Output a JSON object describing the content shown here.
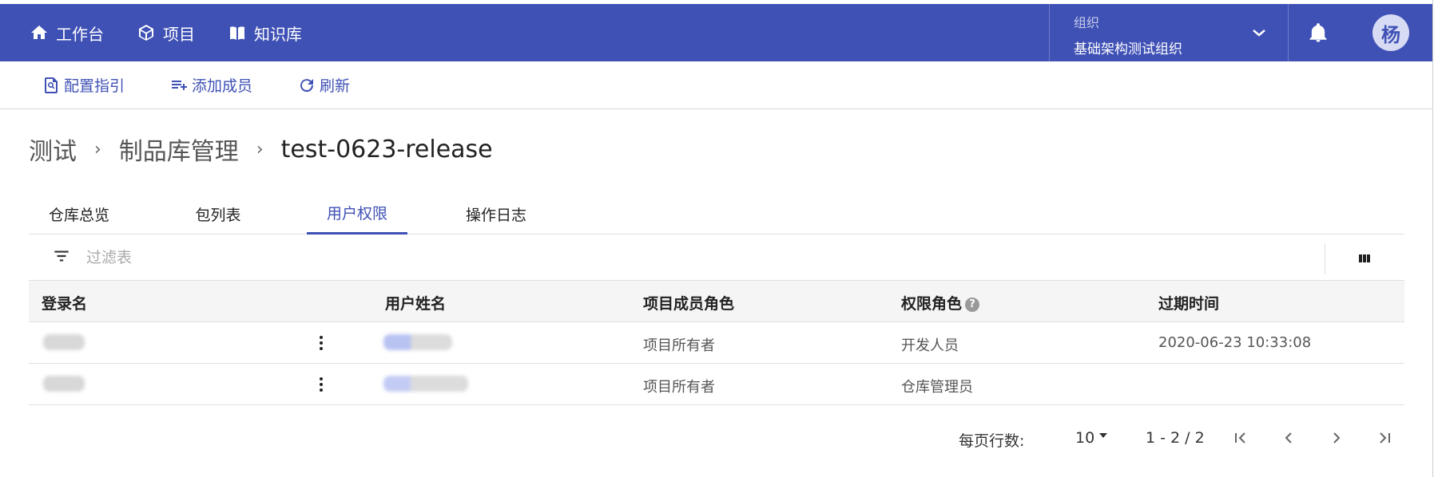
{
  "topnav": {
    "items": [
      {
        "label": "工作台",
        "icon": "home-icon"
      },
      {
        "label": "项目",
        "icon": "cube-icon"
      },
      {
        "label": "知识库",
        "icon": "book-icon"
      }
    ],
    "org_label": "组织",
    "org_name": "基础架构测试组织",
    "avatar_text": "杨"
  },
  "toolbar": {
    "config_guide": "配置指引",
    "add_member": "添加成员",
    "refresh": "刷新"
  },
  "breadcrumb": {
    "items": [
      "测试",
      "制品库管理",
      "test-0623-release"
    ]
  },
  "tabs": [
    "仓库总览",
    "包列表",
    "用户权限",
    "操作日志"
  ],
  "active_tab": "用户权限",
  "filter": {
    "placeholder": "过滤表"
  },
  "table": {
    "headers": [
      "登录名",
      "用户姓名",
      "项目成员角色",
      "权限角色",
      "过期时间"
    ],
    "rows": [
      {
        "login": "",
        "name": "",
        "member_role": "项目所有者",
        "permission_role": "开发人员",
        "expires": "2020-06-23 10:33:08"
      },
      {
        "login": "",
        "name": "",
        "member_role": "项目所有者",
        "permission_role": "仓库管理员",
        "expires": ""
      }
    ]
  },
  "pagination": {
    "rows_per_page_label": "每页行数:",
    "rows_per_page": "10",
    "range": "1 - 2 / 2"
  },
  "colors": {
    "primary": "#3f51b5",
    "header_bg": "#f5f5f5"
  }
}
